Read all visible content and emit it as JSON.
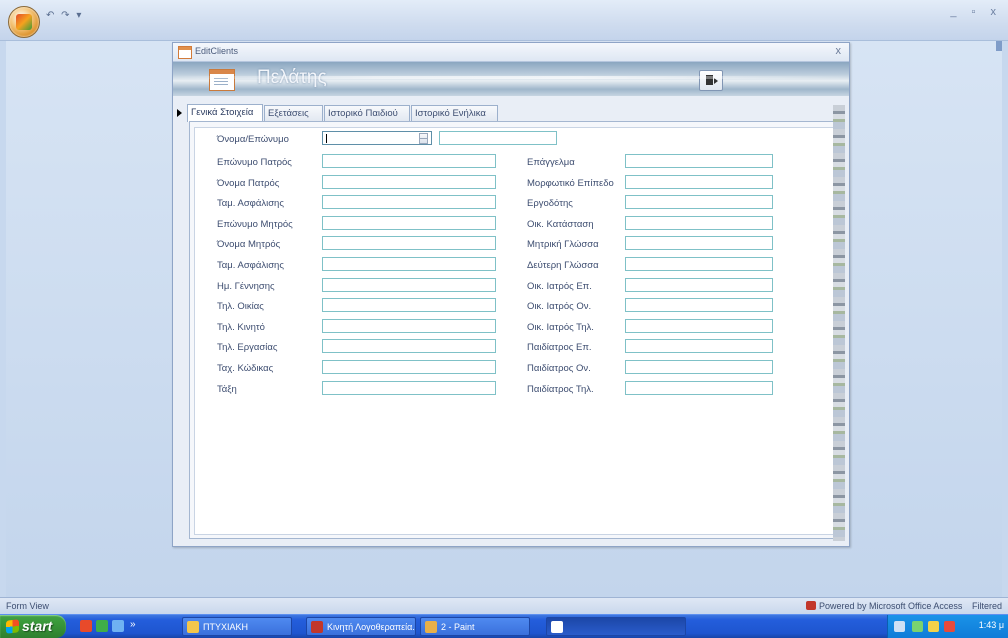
{
  "app": {
    "qat_glyphs": "↶ ↷ ▾",
    "window_controls": "_ ▫ x"
  },
  "form": {
    "window_title": "EditClients",
    "close_glyph": "x",
    "header_title": "Πελάτης",
    "tabs": [
      {
        "label": "Γενικά Στοιχεία",
        "active": true
      },
      {
        "label": "Εξετάσεις",
        "active": false
      },
      {
        "label": "Ιστορικό Παιδιού",
        "active": false
      },
      {
        "label": "Ιστορικό Ενήλικα",
        "active": false
      }
    ],
    "name_label": "Όνομα/Επώνυμο",
    "left_fields": [
      {
        "label": "Επώνυμο Πατρός",
        "value": ""
      },
      {
        "label": "Όνομα Πατρός",
        "value": ""
      },
      {
        "label": "Ταμ. Ασφάλισης",
        "value": ""
      },
      {
        "label": "Επώνυμο Μητρός",
        "value": ""
      },
      {
        "label": "Όνομα Μητρός",
        "value": ""
      },
      {
        "label": "Ταμ. Ασφάλισης",
        "value": ""
      },
      {
        "label": "Ημ. Γέννησης",
        "value": ""
      },
      {
        "label": "Τηλ. Οικίας",
        "value": ""
      },
      {
        "label": "Τηλ. Κινητό",
        "value": ""
      },
      {
        "label": "Τηλ. Εργασίας",
        "value": ""
      },
      {
        "label": "Ταχ. Κώδικας",
        "value": ""
      },
      {
        "label": "Τάξη",
        "value": ""
      }
    ],
    "right_fields": [
      {
        "label": "Επάγγελμα",
        "value": ""
      },
      {
        "label": "Μορφωτικό Επίπεδο",
        "value": ""
      },
      {
        "label": "Εργοδότης",
        "value": ""
      },
      {
        "label": "Οικ. Κατάσταση",
        "value": ""
      },
      {
        "label": "Μητρική Γλώσσα",
        "value": ""
      },
      {
        "label": "Δεύτερη Γλώσσα",
        "value": ""
      },
      {
        "label": "Οικ. Ιατρός Επ.",
        "value": ""
      },
      {
        "label": "Οικ. Ιατρός Ον.",
        "value": ""
      },
      {
        "label": "Οικ. Ιατρός Τηλ.",
        "value": ""
      },
      {
        "label": "Παιδίατρος Επ.",
        "value": ""
      },
      {
        "label": "Παιδίατρος Ον.",
        "value": ""
      },
      {
        "label": "Παιδίατρος Τηλ.",
        "value": ""
      }
    ]
  },
  "status": {
    "view": "Form View",
    "powered": "Powered by Microsoft Office Access",
    "filter": "Filtered"
  },
  "taskbar": {
    "start": "start",
    "overflow": "»",
    "buttons": [
      {
        "label": "ΠΤΥΧΙΑΚΗ",
        "pressed": false
      },
      {
        "label": "Κινητή Λογοθεραπεία...",
        "pressed": false
      },
      {
        "label": "2 - Paint",
        "pressed": false
      },
      {
        "label": "",
        "pressed": true
      }
    ],
    "clock": "1:43 μ"
  },
  "colors": {
    "field_border": "#7fc1c7",
    "label_text": "#3d4d70",
    "taskbar_blue": "#245edc",
    "start_green": "#3a9a3a"
  }
}
